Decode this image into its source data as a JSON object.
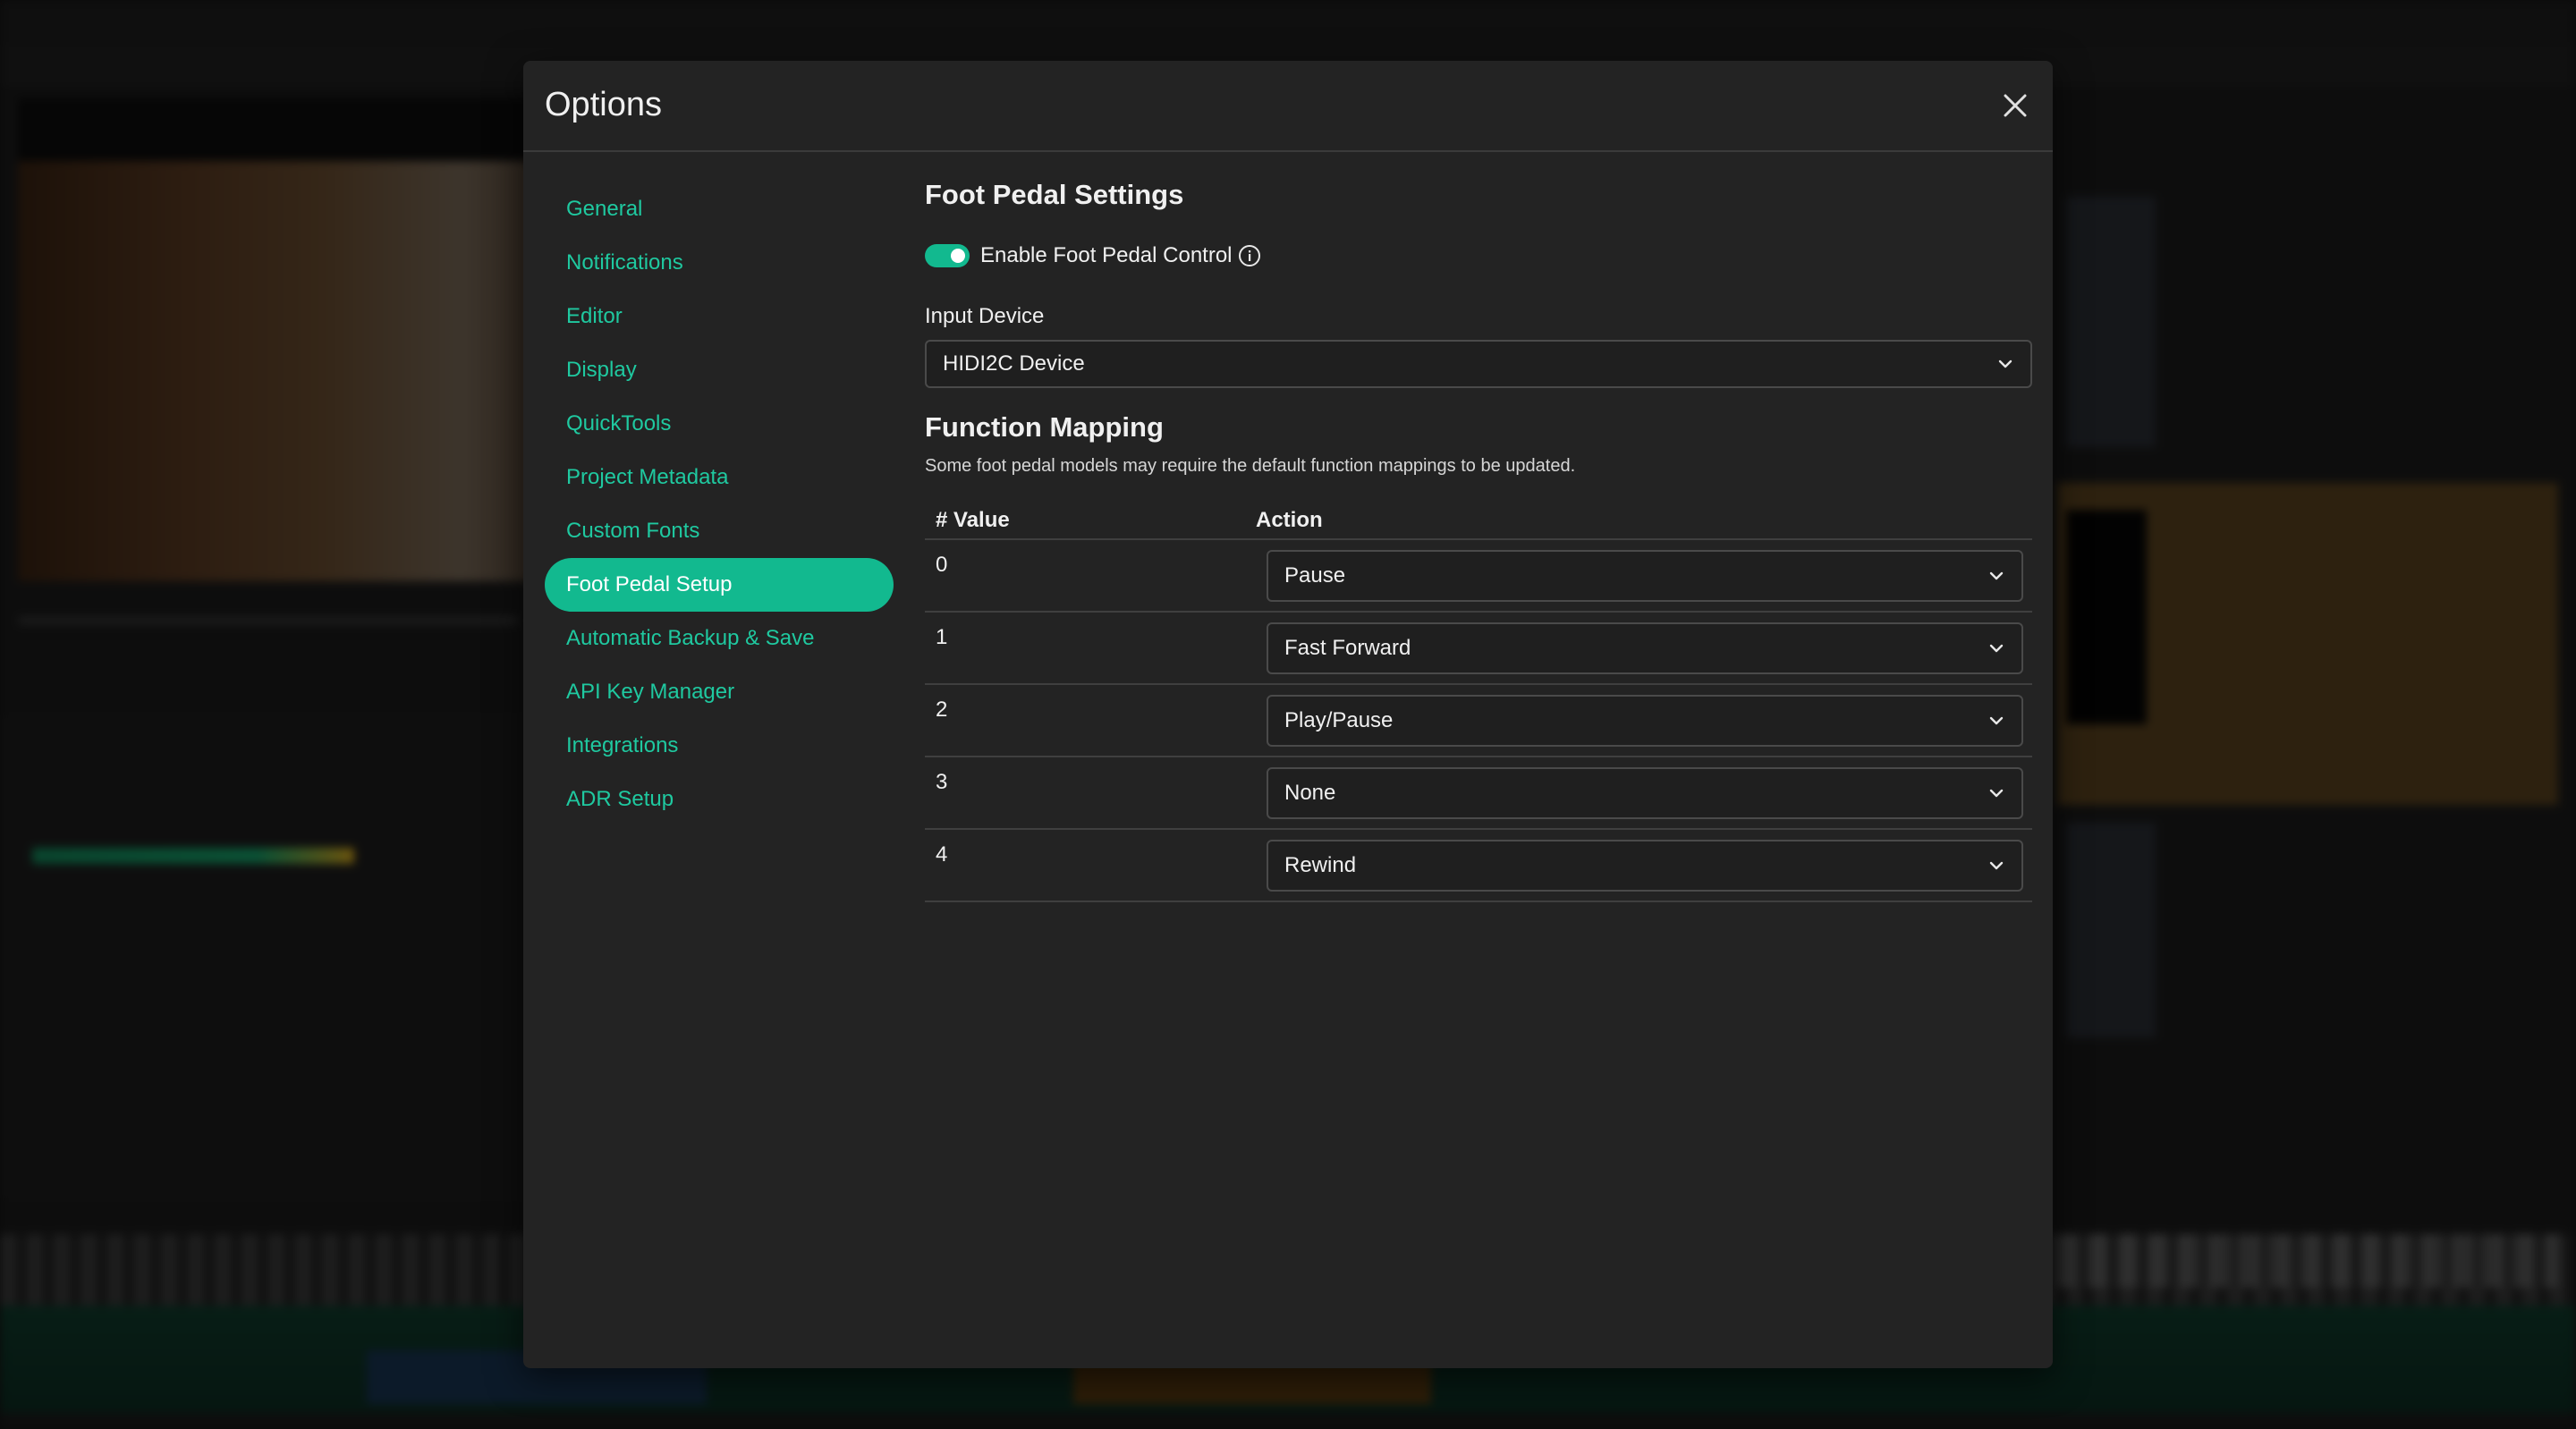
{
  "dialog": {
    "title": "Options"
  },
  "sidebar": {
    "items": [
      {
        "label": "General"
      },
      {
        "label": "Notifications"
      },
      {
        "label": "Editor"
      },
      {
        "label": "Display"
      },
      {
        "label": "QuickTools"
      },
      {
        "label": "Project Metadata"
      },
      {
        "label": "Custom Fonts"
      },
      {
        "label": "Foot Pedal Setup",
        "active": true
      },
      {
        "label": "Automatic Backup & Save"
      },
      {
        "label": "API Key Manager"
      },
      {
        "label": "Integrations"
      },
      {
        "label": "ADR Setup"
      }
    ]
  },
  "foot_pedal": {
    "section_title": "Foot Pedal Settings",
    "enable_label": "Enable Foot Pedal Control",
    "enabled": true,
    "input_device_label": "Input Device",
    "input_device_value": "HIDI2C Device",
    "mapping_title": "Function Mapping",
    "mapping_help": "Some foot pedal models may require the default function mappings to be updated.",
    "columns": {
      "value": "# Value",
      "action": "Action"
    },
    "rows": [
      {
        "value": "0",
        "action": "Pause"
      },
      {
        "value": "1",
        "action": "Fast Forward"
      },
      {
        "value": "2",
        "action": "Play/Pause"
      },
      {
        "value": "3",
        "action": "None"
      },
      {
        "value": "4",
        "action": "Rewind"
      }
    ]
  },
  "colors": {
    "accent": "#12b98f",
    "link": "#1fc9a0",
    "dialog_bg": "#232323"
  },
  "icons": {
    "close": "close-icon",
    "info": "info-icon",
    "dropdown": "chevron-down-icon"
  }
}
